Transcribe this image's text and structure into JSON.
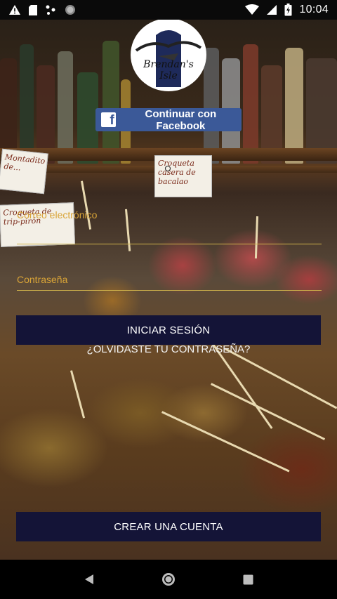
{
  "status_bar": {
    "left_icons": [
      "warning-icon",
      "sd-card-icon",
      "dots-icon",
      "circle-icon"
    ],
    "right_icons": [
      "wifi-icon",
      "signal-icon",
      "battery-icon"
    ],
    "time": "10:04"
  },
  "logo": {
    "name": "Brendan's Isle"
  },
  "facebook_button": {
    "label": "Continuar con Facebook",
    "color": "#3b5998"
  },
  "background_signs": {
    "sign_1": "Montadito de...",
    "sign_2": "Croqueta de trip-pirón",
    "sign_3": "Croqueta casera de bacalao"
  },
  "form": {
    "email_placeholder": "Correo electrónico",
    "password_placeholder": "Contraseña",
    "login_label": "INICIAR SESIÓN",
    "forgot_label": "¿OLVIDASTE TU CONTRASEÑA?",
    "create_label": "CREAR UNA CUENTA"
  },
  "nav_bar": {
    "icons": [
      "back-icon",
      "home-icon",
      "recents-icon"
    ]
  },
  "colors": {
    "button_bg": "#141437",
    "accent_label": "#d9a437",
    "field_line": "#cfb24a"
  }
}
